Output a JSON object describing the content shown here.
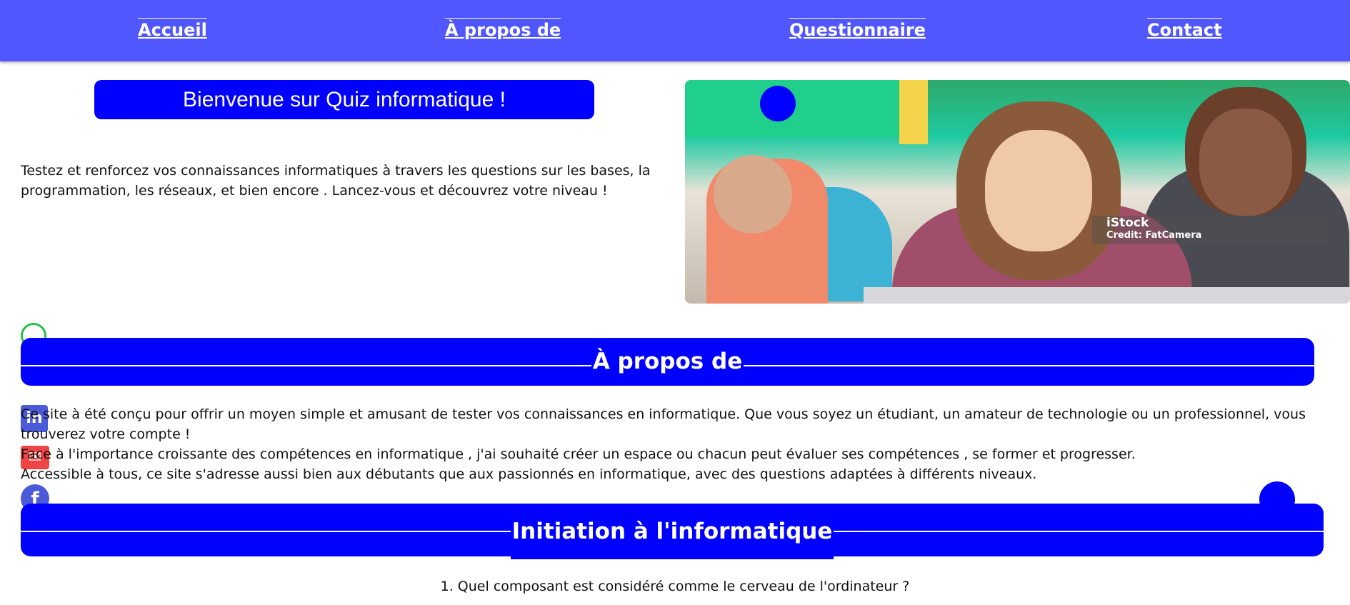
{
  "nav": {
    "items": [
      {
        "label": "Accueil"
      },
      {
        "label": "À propos de"
      },
      {
        "label": "Questionnaire"
      },
      {
        "label": "Contact"
      }
    ]
  },
  "hero": {
    "welcome_title": "Bienvenue sur Quiz informatique !",
    "intro": "Testez et renforcez vos connaissances informatiques à travers les questions sur les bases, la programmation, les réseaux, et bien encore . Lancez-vous et découvrez votre niveau !",
    "image_watermark_brand": "iStock",
    "image_watermark_credit": "Credit: FatCamera"
  },
  "about": {
    "title": "À propos de",
    "paragraphs": [
      "Ce site à été conçu pour offrir un moyen simple et amusant de tester vos connaissances en informatique. Que vous soyez un étudiant, un amateur de technologie ou un professionnel, vous trouverez votre compte !",
      "Face à l'importance croissante des compétences en informatique , j'ai souhaité créer un espace ou chacun peut évaluer ses compétences , se former et progresser.",
      "Accessible à tous, ce site s'adresse aussi bien aux débutants que aux passionnés en informatique, avec des questions adaptées à différents niveaux."
    ]
  },
  "social": {
    "icons": [
      "whatsapp-icon",
      "linkedin-icon",
      "mail-icon",
      "facebook-icon"
    ]
  },
  "quiz": {
    "section_title": "Initiation à l'informatique",
    "question_1": "1. Quel composant est considéré comme le cerveau de l'ordinateur ?"
  },
  "colors": {
    "nav_bg": "#5157ff",
    "band_bg": "#0000ff"
  }
}
